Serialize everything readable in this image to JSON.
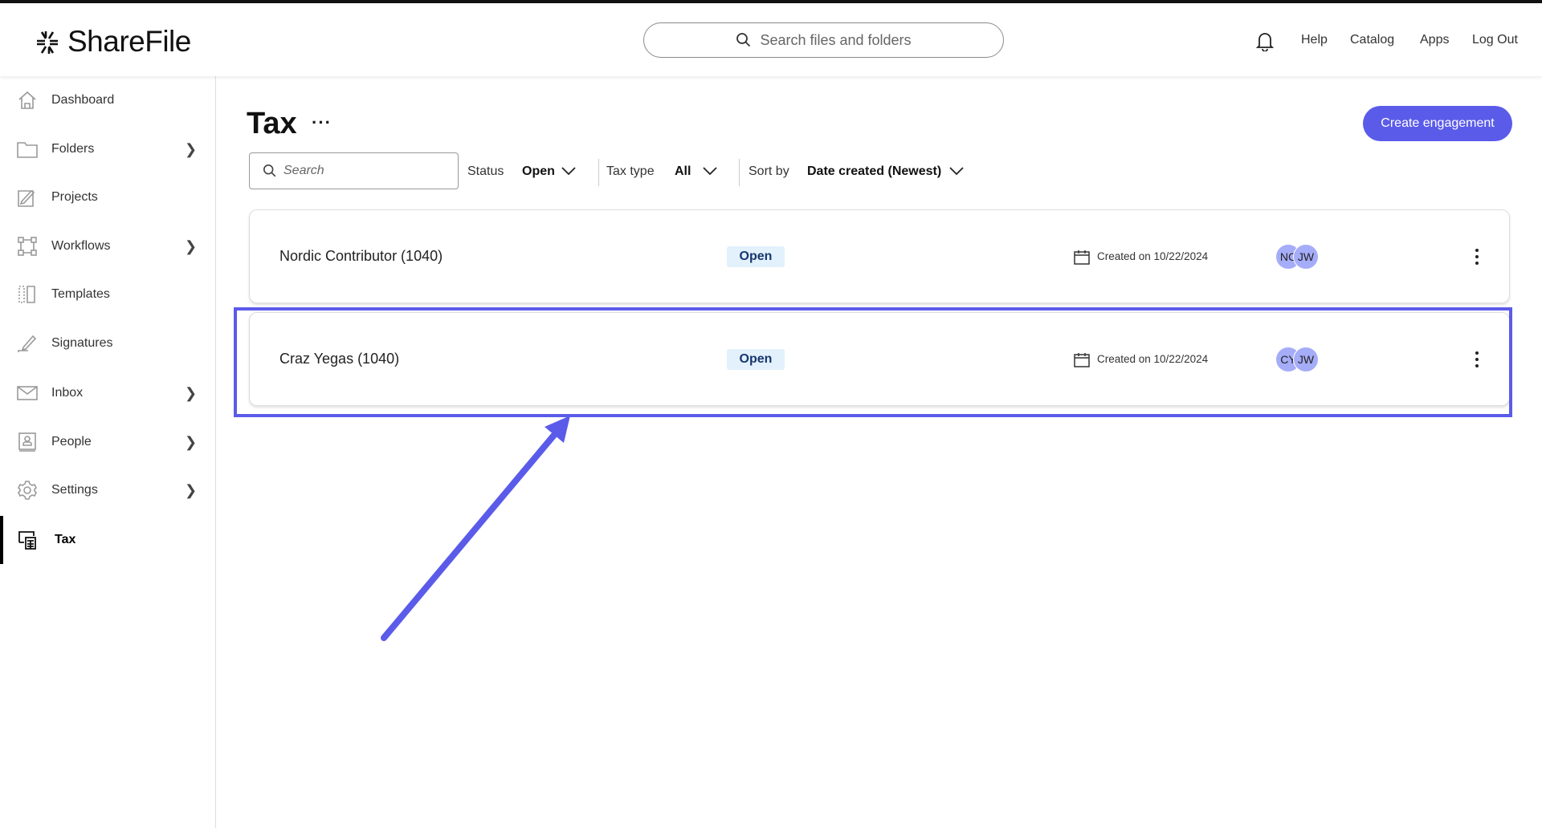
{
  "app": {
    "name": "ShareFile"
  },
  "header": {
    "search_placeholder": "Search files and folders",
    "links": [
      "Help",
      "Catalog",
      "Apps",
      "Log Out"
    ]
  },
  "sidebar": {
    "items": [
      {
        "label": "Dashboard",
        "icon": "home-icon"
      },
      {
        "label": "Folders",
        "icon": "folder-icon",
        "has_submenu": true
      },
      {
        "label": "Projects",
        "icon": "projects-icon"
      },
      {
        "label": "Workflows",
        "icon": "workflows-icon",
        "has_submenu": true
      },
      {
        "label": "Templates",
        "icon": "templates-icon"
      },
      {
        "label": "Signatures",
        "icon": "signature-icon"
      },
      {
        "label": "Inbox",
        "icon": "mail-icon",
        "has_submenu": true
      },
      {
        "label": "People",
        "icon": "people-icon",
        "has_submenu": true
      },
      {
        "label": "Settings",
        "icon": "gear-icon",
        "has_submenu": true
      },
      {
        "label": "Tax",
        "icon": "tax-calculator-icon",
        "active": true
      }
    ]
  },
  "main": {
    "title": "Tax",
    "more_label": "···",
    "create_button": "Create engagement",
    "search_placeholder": "Search",
    "filters": {
      "status_label": "Status",
      "status_value": "Open",
      "taxtype_label": "Tax type",
      "taxtype_value": "All",
      "sortby_label": "Sort by",
      "sortby_value": "Date created (Newest)"
    },
    "engagements": [
      {
        "name": "Nordic Contributor (1040)",
        "status": "Open",
        "created": "Created on 10/22/2024",
        "avatars": [
          "NC",
          "JW"
        ]
      },
      {
        "name": "Craz Yegas (1040)",
        "status": "Open",
        "created": "Created on 10/22/2024",
        "avatars": [
          "CY",
          "JW"
        ],
        "highlighted": true
      }
    ]
  },
  "colors": {
    "accent": "#5b5bea",
    "badge_bg": "#e2f1fc",
    "avatar": "#a5acf8"
  }
}
